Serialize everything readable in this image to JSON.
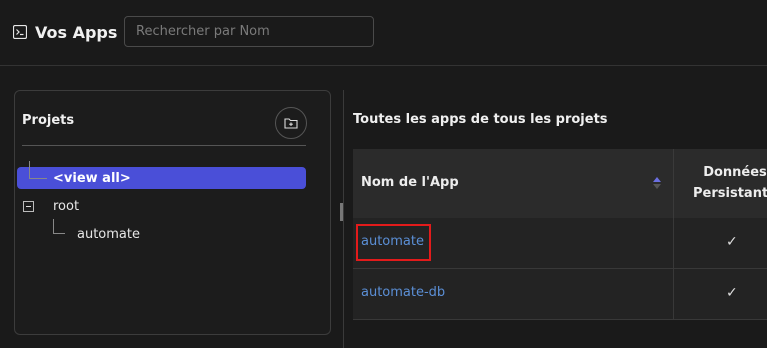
{
  "header": {
    "title": "Vos Apps",
    "search_placeholder": "Rechercher par Nom"
  },
  "projects": {
    "title": "Projets",
    "tree": [
      {
        "label": "<view all>",
        "selected": true
      },
      {
        "label": "root",
        "expanded": true
      },
      {
        "label": "automate"
      }
    ]
  },
  "main": {
    "title": "Toutes les apps de tous les projets",
    "columns": [
      "Nom de l'App",
      "Données Persistante"
    ],
    "rows": [
      {
        "name": "automate",
        "persistent": "✓",
        "highlighted": true
      },
      {
        "name": "automate-db",
        "persistent": "✓"
      }
    ]
  },
  "colors": {
    "accent": "#4a4fd8",
    "link": "#5b8fd6",
    "highlight": "#e31b1b"
  }
}
